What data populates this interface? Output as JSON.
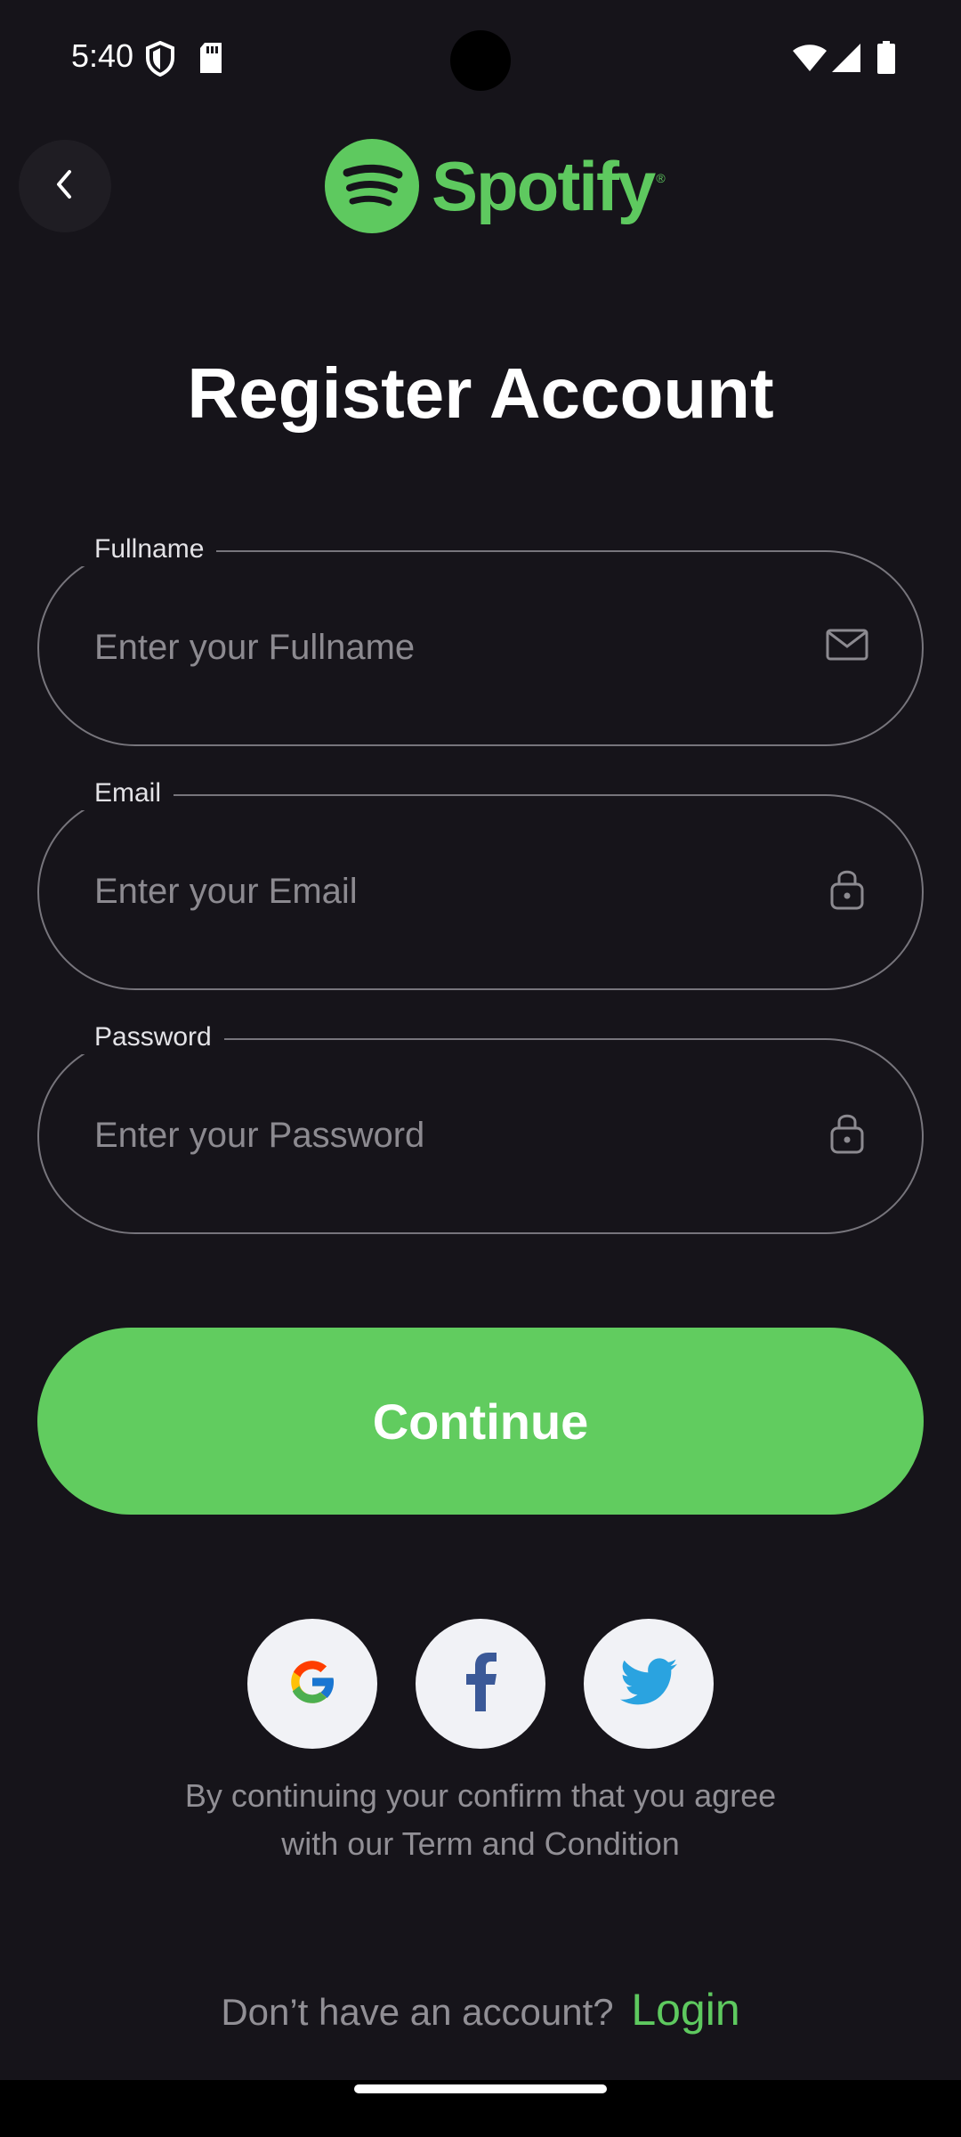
{
  "status_bar": {
    "time": "5:40",
    "left_icons": [
      "shield-icon",
      "sd-card-icon"
    ],
    "right_icons": [
      "wifi-icon",
      "signal-icon",
      "battery-icon"
    ]
  },
  "header": {
    "back_icon": "chevron-left-icon",
    "logo_text": "Spotify",
    "logo_mark": "®"
  },
  "title": "Register Account",
  "form": {
    "fullname": {
      "label": "Fullname",
      "placeholder": "Enter your Fullname",
      "value": "",
      "icon": "mail-icon"
    },
    "email": {
      "label": "Email",
      "placeholder": "Enter your Email",
      "value": "",
      "icon": "lock-icon"
    },
    "password": {
      "label": "Password",
      "placeholder": "Enter your Password",
      "value": "",
      "icon": "lock-icon"
    }
  },
  "continue_label": "Continue",
  "social": [
    "google-icon",
    "facebook-icon",
    "twitter-icon"
  ],
  "terms": {
    "line1": "By continuing your confirm that you agree",
    "line2": "with our Term and Condition"
  },
  "footer": {
    "prompt": "Don’t have an account?",
    "login_label": "Login"
  },
  "colors": {
    "background": "#16141a",
    "accent": "#61cc5f",
    "border": "#77757c",
    "muted_text": "#918f95"
  }
}
